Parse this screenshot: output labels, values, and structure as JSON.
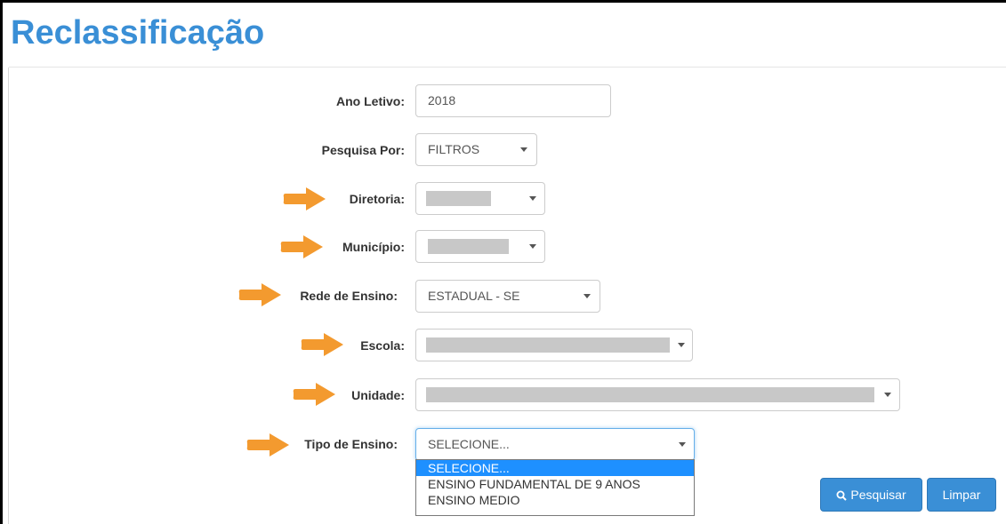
{
  "page": {
    "title": "Reclassificação"
  },
  "form": {
    "ano_letivo": {
      "label": "Ano Letivo:",
      "value": "2018"
    },
    "pesquisa_por": {
      "label": "Pesquisa Por:",
      "value": "FILTROS"
    },
    "diretoria": {
      "label": "Diretoria:",
      "value": ""
    },
    "municipio": {
      "label": "Município:",
      "value": ""
    },
    "rede_ensino": {
      "label": "Rede de Ensino:",
      "value": "ESTADUAL - SE"
    },
    "escola": {
      "label": "Escola:",
      "value": ""
    },
    "unidade": {
      "label": "Unidade:",
      "value": ""
    },
    "tipo_ensino": {
      "label": "Tipo de Ensino:",
      "value": "SELECIONE...",
      "options": [
        "SELECIONE...",
        "ENSINO FUNDAMENTAL DE 9 ANOS",
        "ENSINO MEDIO"
      ]
    }
  },
  "actions": {
    "search_label": "Pesquisar",
    "clear_label": "Limpar"
  },
  "icons": {
    "arrow": "arrow-right-icon",
    "caret": "caret-down-icon",
    "search": "search-icon"
  },
  "colors": {
    "title": "#3a8fd6",
    "arrow": "#f39a2f",
    "button": "#3a8fd6",
    "selected_option": "#1e90ff"
  }
}
